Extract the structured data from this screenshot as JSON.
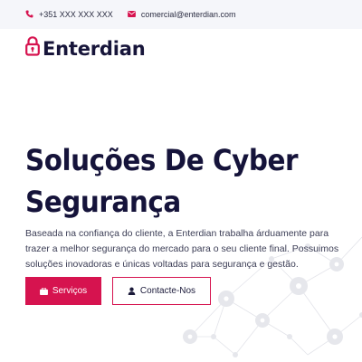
{
  "topbar": {
    "phone": "+351 XXX XXX XXX",
    "email": "comercial@enterdian.com",
    "phone_icon": "phone-icon",
    "email_icon": "envelope-icon"
  },
  "brand": {
    "name": "Enterdian",
    "logo_icon": "padlock-icon",
    "accent": "#d6134f",
    "dark": "#15133a"
  },
  "hero": {
    "title_line1": "Soluções De Cyber",
    "title_line2": "Segurança",
    "description": "Baseada na confiança do cliente, a Enterdian trabalha árduamente para trazer a melhor segurança do mercado para o seu cliente final. Possuimos soluções inovadoras e únicas voltadas para segurança e gestão.",
    "primary_button": "Serviços",
    "secondary_button": "Contacte-Nos",
    "primary_icon": "briefcase-icon",
    "secondary_icon": "user-icon"
  }
}
